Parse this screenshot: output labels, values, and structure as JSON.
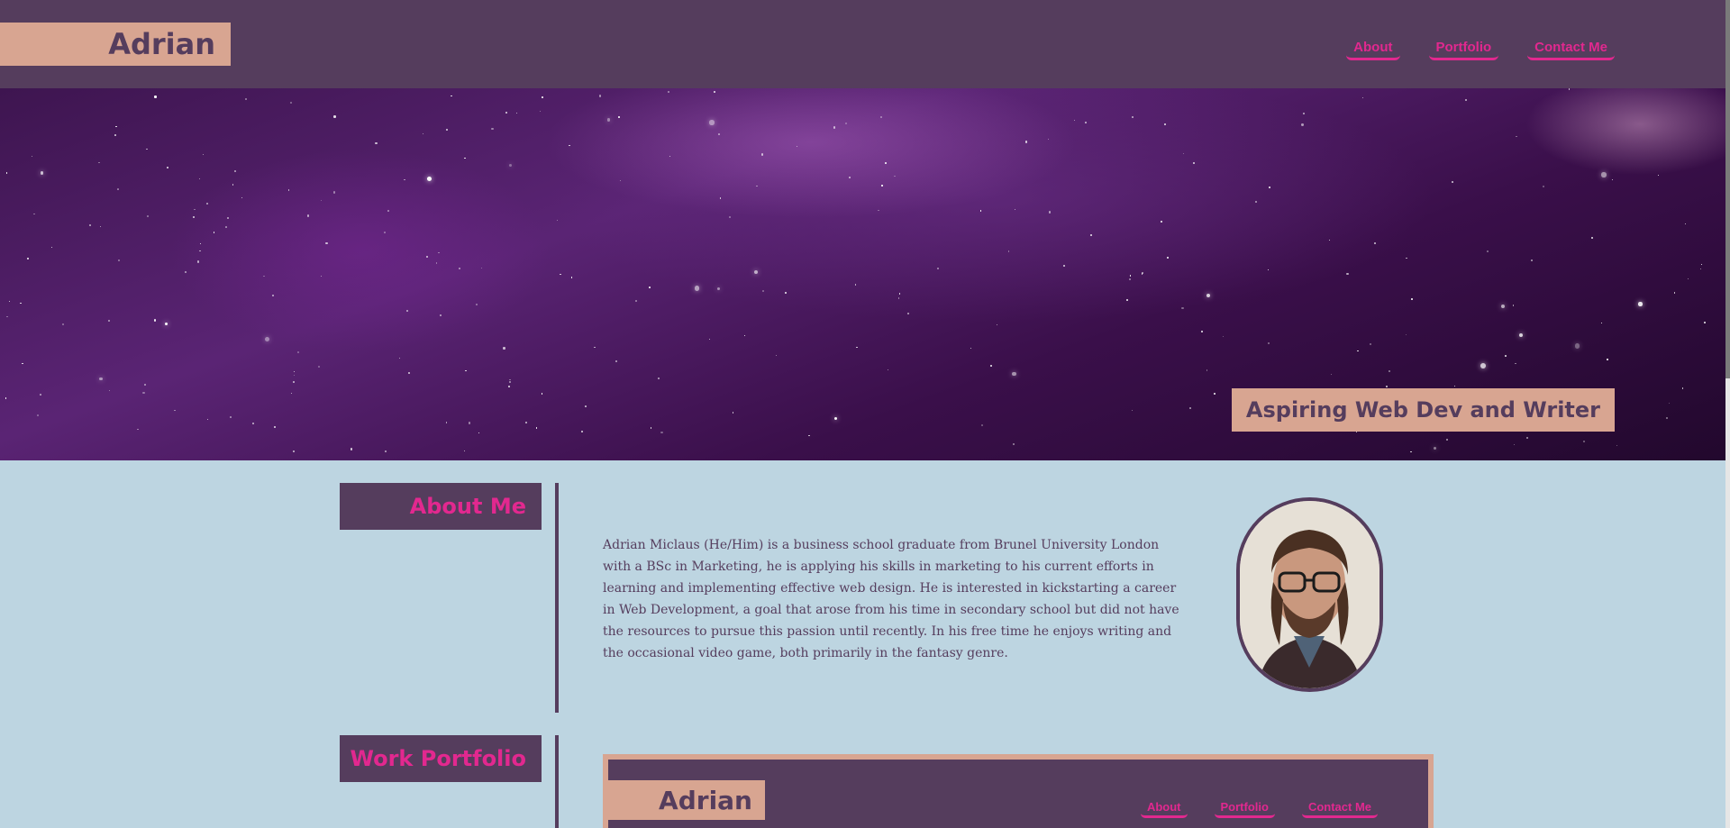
{
  "header": {
    "brand": "Adrian",
    "nav": [
      "About",
      "Portfolio",
      "Contact Me"
    ]
  },
  "hero": {
    "tagline": "Aspiring Web Dev and Writer"
  },
  "about": {
    "title": "About Me",
    "text": "Adrian Miclaus (He/Him) is a business school graduate from Brunel University London with a BSc in Marketing, he is applying his skills in marketing to his current efforts in learning and implementing effective web design. He is interested in kickstarting a career in Web Development, a goal that arose from his time in secondary school but did not have the resources to pursue this passion until recently. In his free time he enjoys writing and the occasional video game, both primarily in the fantasy genre."
  },
  "portfolio": {
    "title": "Work Portfolio",
    "preview_brand": "Adrian",
    "preview_nav": [
      "About",
      "Portfolio",
      "Contact Me"
    ]
  },
  "colors": {
    "header_bg": "#553d5d",
    "accent": "#e2288f",
    "brand_bg": "#d8a591",
    "page_bg": "#bdd5e1"
  }
}
